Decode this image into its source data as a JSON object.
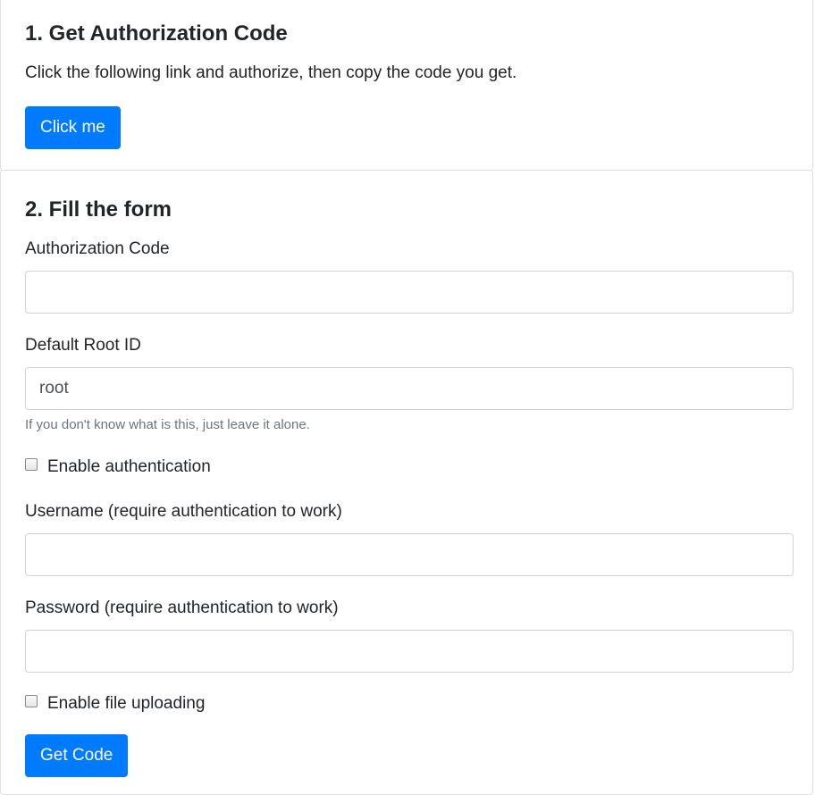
{
  "step1": {
    "title": "1. Get Authorization Code",
    "instruction": "Click the following link and authorize, then copy the code you get.",
    "button_label": "Click me"
  },
  "step2": {
    "title": "2. Fill the form",
    "auth_code": {
      "label": "Authorization Code",
      "value": ""
    },
    "root_id": {
      "label": "Default Root ID",
      "value": "root",
      "help": "If you don't know what is this, just leave it alone."
    },
    "enable_auth": {
      "label": "Enable authentication",
      "checked": false
    },
    "username": {
      "label": "Username (require authentication to work)",
      "value": ""
    },
    "password": {
      "label": "Password (require authentication to work)",
      "value": ""
    },
    "enable_upload": {
      "label": "Enable file uploading",
      "checked": false
    },
    "submit_label": "Get Code"
  },
  "colors": {
    "primary": "#007bff",
    "muted": "#6c757d",
    "border": "#ced4da"
  }
}
